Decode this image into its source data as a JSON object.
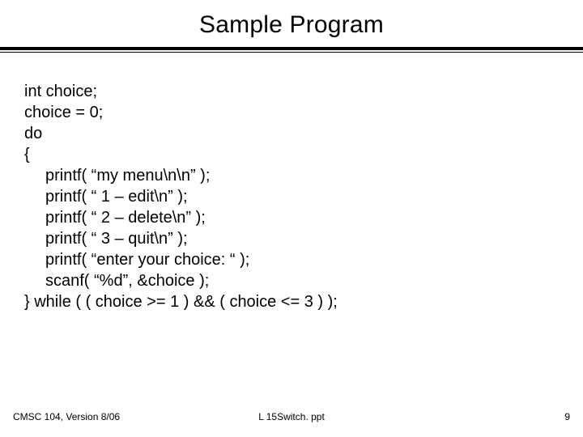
{
  "title": "Sample Program",
  "code": {
    "l1": "int choice;",
    "l2": "choice = 0;",
    "l3": "do",
    "l4": "{",
    "l5": "printf( “my menu\\n\\n” );",
    "l6": "printf( “ 1 – edit\\n” );",
    "l7": "printf( “ 2 – delete\\n” );",
    "l8": "printf( “ 3 – quit\\n” );",
    "l9": "printf( “enter your choice: “ );",
    "l10": "scanf( “%d”, &choice  );",
    "l11": "} while ( ( choice >= 1 ) && ( choice <= 3 ) );"
  },
  "footer": {
    "left": "CMSC 104, Version 8/06",
    "center": "L 15Switch. ppt",
    "right": "9"
  }
}
